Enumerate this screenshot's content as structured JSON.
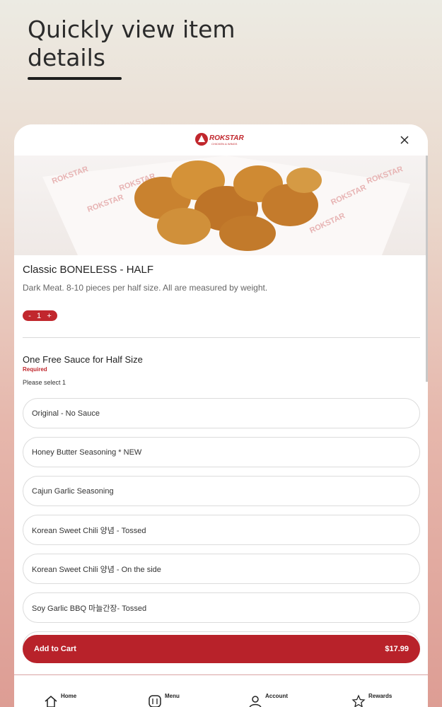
{
  "promo": {
    "title": "Quickly view item details"
  },
  "brand": {
    "logo_text": "ROKSTAR",
    "logo_subtext": "CHICKEN & WINGS",
    "accent_color": "#c1272d"
  },
  "item": {
    "name": "Classic BONELESS - HALF",
    "description": "Dark Meat. 8-10 pieces per half size. All are measured by weight.",
    "quantity": {
      "minus": "-",
      "value": "1",
      "plus": "+"
    }
  },
  "modifier_group": {
    "title": "One Free Sauce for Half Size",
    "required_label": "Required",
    "hint": "Please select 1",
    "options": [
      "Original - No Sauce",
      "Honey Butter Seasoning * NEW",
      "Cajun Garlic Seasoning",
      "Korean Sweet Chili 양념 - Tossed",
      "Korean Sweet Chili 양념 - On the side",
      "Soy Garlic BBQ 마늘간장- Tossed"
    ]
  },
  "cart": {
    "label": "Add to Cart",
    "price": "$17.99"
  },
  "nav": {
    "items": [
      {
        "label": "Home",
        "icon": "home-icon"
      },
      {
        "label": "Menu",
        "icon": "menu-icon"
      },
      {
        "label": "Account",
        "icon": "account-icon"
      },
      {
        "label": "Rewards",
        "icon": "star-icon"
      }
    ]
  }
}
